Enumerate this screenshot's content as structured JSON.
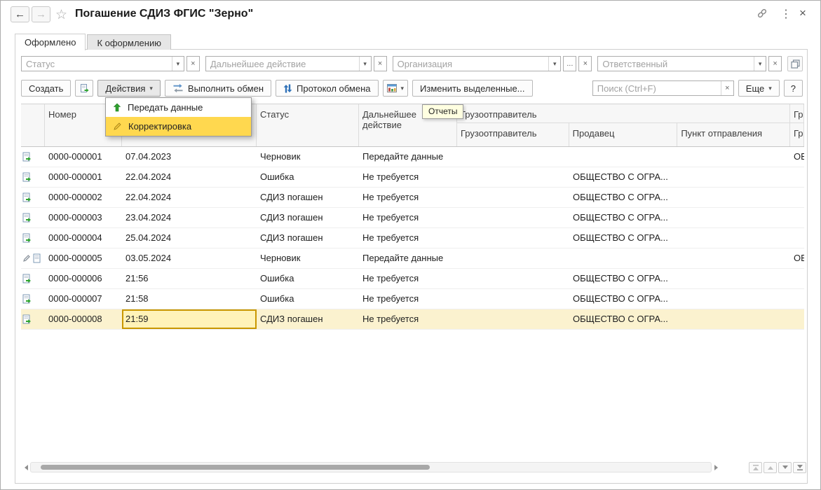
{
  "window": {
    "title": "Погашение СДИЗ ФГИС \"Зерно\""
  },
  "icons": {
    "back": "←",
    "forward": "→",
    "star": "☆",
    "menu_dots": "⋮",
    "close": "×",
    "dropdown": "▾",
    "clear": "×",
    "ellipsis": "...",
    "help": "?"
  },
  "tabs": [
    {
      "label": "Оформлено",
      "active": true
    },
    {
      "label": "К оформлению",
      "active": false
    }
  ],
  "filters": {
    "status": "Статус",
    "next_action": "Дальнейшее действие",
    "organization": "Организация",
    "responsible": "Ответственный"
  },
  "toolbar": {
    "create": "Создать",
    "actions": "Действия",
    "run_exchange": "Выполнить обмен",
    "exchange_protocol": "Протокол обмена",
    "edit_selected": "Изменить выделенные...",
    "search_placeholder": "Поиск (Ctrl+F)",
    "more": "Еще"
  },
  "actions_menu": {
    "items": [
      {
        "label": "Передать данные"
      },
      {
        "label": "Корректировка"
      }
    ]
  },
  "tooltip": {
    "text": "Отчеты"
  },
  "table": {
    "headers": {
      "number": "Номер",
      "status": "Статус",
      "next_action": "Дальнейшее действие",
      "consignor_group": "Грузоотправитель",
      "consignor": "Грузоотправитель",
      "seller": "Продавец",
      "departure": "Пункт отправления",
      "truncated_group": "Гр",
      "truncated_sub": "Гр"
    },
    "rows": [
      {
        "number": "0000-000001",
        "date": "07.04.2023",
        "status": "Черновик",
        "next_action": "Передайте данные",
        "consignor": "",
        "seller": "",
        "departure": "",
        "extra": "ОБ",
        "pencil": false,
        "selected": false,
        "editing": false
      },
      {
        "number": "0000-000001",
        "date": "22.04.2024",
        "status": "Ошибка",
        "next_action": "Не требуется",
        "consignor": "",
        "seller": "ОБЩЕСТВО С ОГРА...",
        "departure": "",
        "extra": "",
        "pencil": false,
        "selected": false,
        "editing": false
      },
      {
        "number": "0000-000002",
        "date": "22.04.2024",
        "status": "СДИЗ погашен",
        "next_action": "Не требуется",
        "consignor": "",
        "seller": "ОБЩЕСТВО С ОГРА...",
        "departure": "",
        "extra": "",
        "pencil": false,
        "selected": false,
        "editing": false
      },
      {
        "number": "0000-000003",
        "date": "23.04.2024",
        "status": "СДИЗ погашен",
        "next_action": "Не требуется",
        "consignor": "",
        "seller": "ОБЩЕСТВО С ОГРА...",
        "departure": "",
        "extra": "",
        "pencil": false,
        "selected": false,
        "editing": false
      },
      {
        "number": "0000-000004",
        "date": "25.04.2024",
        "status": "СДИЗ погашен",
        "next_action": "Не требуется",
        "consignor": "",
        "seller": "ОБЩЕСТВО С ОГРА...",
        "departure": "",
        "extra": "",
        "pencil": false,
        "selected": false,
        "editing": false
      },
      {
        "number": "0000-000005",
        "date": "03.05.2024",
        "status": "Черновик",
        "next_action": "Передайте данные",
        "consignor": "",
        "seller": "",
        "departure": "",
        "extra": "ОБ",
        "pencil": true,
        "selected": false,
        "editing": false
      },
      {
        "number": "0000-000006",
        "date": "21:56",
        "status": "Ошибка",
        "next_action": "Не требуется",
        "consignor": "",
        "seller": "ОБЩЕСТВО С ОГРА...",
        "departure": "",
        "extra": "",
        "pencil": false,
        "selected": false,
        "editing": false
      },
      {
        "number": "0000-000007",
        "date": "21:58",
        "status": "Ошибка",
        "next_action": "Не требуется",
        "consignor": "",
        "seller": "ОБЩЕСТВО С ОГРА...",
        "departure": "",
        "extra": "",
        "pencil": false,
        "selected": false,
        "editing": false
      },
      {
        "number": "0000-000008",
        "date": "21:59",
        "status": "СДИЗ погашен",
        "next_action": "Не требуется",
        "consignor": "",
        "seller": "ОБЩЕСТВО С ОГРА...",
        "departure": "",
        "extra": "",
        "pencil": false,
        "selected": true,
        "editing": true
      }
    ]
  },
  "colors": {
    "menu_highlight": "#FFD84F",
    "selected_row": "#FBF2CF",
    "edit_border": "#C99700",
    "edit_bg": "#FFF3B8",
    "tooltip_bg": "#FFFFE1",
    "accent_green": "#2EA52E",
    "accent_blue": "#2F71B8"
  }
}
